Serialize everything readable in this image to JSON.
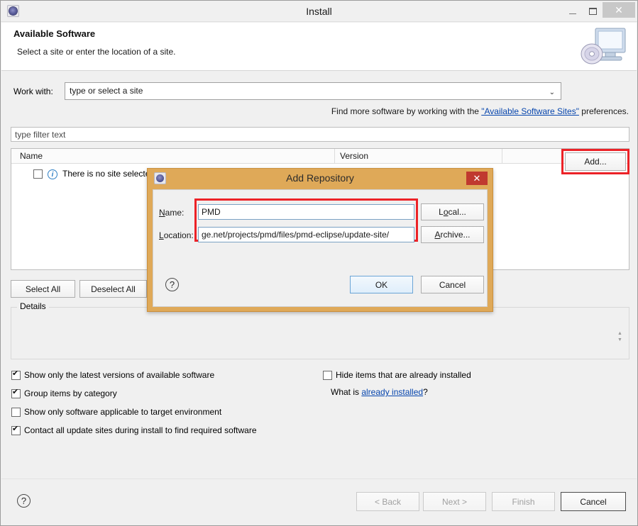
{
  "window": {
    "title": "Install",
    "icon": "eclipse-gear-icon",
    "minimize_label": "−",
    "maximize_label": "□",
    "close_label": "✕"
  },
  "header": {
    "title": "Available Software",
    "subtitle": "Select a site or enter the location of a site.",
    "image": "monitor-disc-icon"
  },
  "work_with": {
    "label": "Work with:",
    "value": "type or select a site",
    "placeholder": "type or select a site",
    "dropdown_glyph": "⌄",
    "add_button": "Add..."
  },
  "find_more": {
    "prefix": "Find more software by working with the ",
    "link": "\"Available Software Sites\"",
    "suffix": " preferences."
  },
  "filter": {
    "placeholder": "type filter text",
    "value": "type filter text"
  },
  "table": {
    "columns": [
      "Name",
      "Version",
      ""
    ],
    "rows": [
      {
        "checked": false,
        "icon": "info-icon",
        "icon_glyph": "i",
        "name": "There is no site selected",
        "version": ""
      }
    ]
  },
  "selection_buttons": {
    "select_all": "Select All",
    "deselect_all": "Deselect All"
  },
  "details": {
    "legend": "Details",
    "text": "",
    "spinner_up": "▲",
    "spinner_down": "▼"
  },
  "options": {
    "left": [
      {
        "label": "Show only the latest versions of available software",
        "checked": true
      },
      {
        "label": "Group items by category",
        "checked": true
      },
      {
        "label": "Show only software applicable to target environment",
        "checked": false
      },
      {
        "label": "Contact all update sites during install to find required software",
        "checked": true
      }
    ],
    "right": [
      {
        "label": "Hide items that are already installed",
        "checked": true
      }
    ],
    "what_is_prefix": "What is ",
    "what_is_link": "already installed",
    "what_is_suffix": "?"
  },
  "footer": {
    "help_glyph": "?",
    "buttons": [
      {
        "label": "< Back",
        "enabled": false
      },
      {
        "label": "Next >",
        "enabled": false
      },
      {
        "label": "Finish",
        "enabled": false
      },
      {
        "label": "Cancel",
        "enabled": true
      }
    ]
  },
  "modal": {
    "title": "Add Repository",
    "icon": "eclipse-gear-icon",
    "close_label": "✕",
    "name_label_pre": "N",
    "name_label_post": "ame:",
    "name_value": "PMD",
    "location_label_pre": "L",
    "location_label_post": "ocation:",
    "location_value": "ge.net/projects/pmd/files/pmd-eclipse/update-site/",
    "local_button_pre": "L",
    "local_button_mid": "o",
    "local_button_post": "cal...",
    "archive_button_pre": "A",
    "archive_button_post": "rchive...",
    "help_glyph": "?",
    "ok_label": "OK",
    "cancel_label": "Cancel"
  },
  "colors": {
    "highlight_red": "#ec2227",
    "modal_titlebar": "#dfa958",
    "modal_close": "#c0392f",
    "link": "#0645ad",
    "default_button_border": "#6ba5d6"
  }
}
